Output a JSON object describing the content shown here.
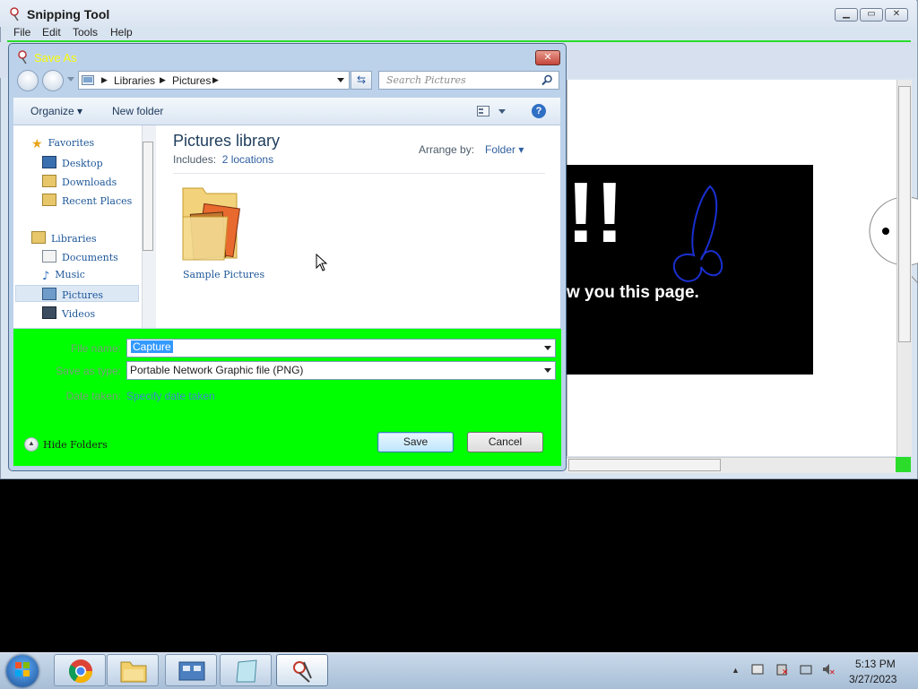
{
  "snipping_tool": {
    "title": "Snipping Tool",
    "menu": [
      "File",
      "Edit",
      "Tools",
      "Help"
    ],
    "canvas_text": "w you this page.",
    "canvas_exclaim": "!!"
  },
  "dialog": {
    "title": "Save As",
    "breadcrumb": [
      "Libraries",
      "Pictures"
    ],
    "search_placeholder": "Search Pictures",
    "toolbar": {
      "organize": "Organize",
      "new_folder": "New folder"
    },
    "nav": {
      "favorites": "Favorites",
      "favorites_items": [
        "Desktop",
        "Downloads",
        "Recent Places"
      ],
      "libraries": "Libraries",
      "libraries_items": [
        "Documents",
        "Music",
        "Pictures",
        "Videos"
      ],
      "selected": "Pictures"
    },
    "library": {
      "title": "Pictures library",
      "includes_label": "Includes:",
      "includes_link": "2 locations",
      "arrange_label": "Arrange by:",
      "arrange_value": "Folder"
    },
    "items": [
      {
        "name": "Sample Pictures",
        "icon": "folder-pictures-icon"
      }
    ],
    "form": {
      "filename_label": "File name:",
      "filename_value": "Capture",
      "type_label": "Save as type:",
      "type_value": "Portable Network Graphic file (PNG)",
      "date_label": "Date taken:",
      "date_link": "Specify date taken"
    },
    "hide_folders": "Hide Folders",
    "save": "Save",
    "cancel": "Cancel"
  },
  "taskbar": {
    "time": "5:13 PM",
    "date": "3/27/2023",
    "pinned": [
      "chrome-icon",
      "explorer-icon",
      "control-panel-icon",
      "notepad-icon",
      "snipping-tool-icon"
    ]
  },
  "colors": {
    "highlight_green": "#00ff00",
    "selection_blue": "#3399ff",
    "dialog_title_yellow": "#f7f700"
  }
}
